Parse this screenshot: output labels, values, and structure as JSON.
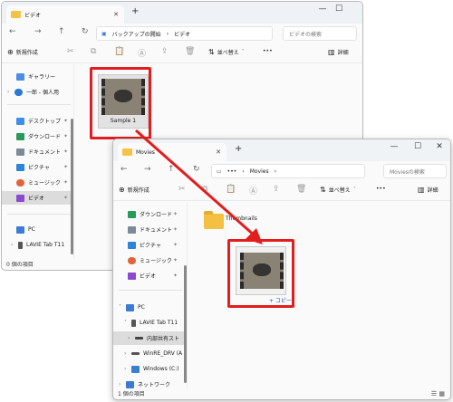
{
  "window_back": {
    "tab_title": "ビデオ",
    "address_segments": [
      "バックアップの開始",
      "›",
      "ビデオ"
    ],
    "search_placeholder": "ビデオの検索",
    "toolbar": {
      "new_label": "新規作成",
      "sort_label": "並べ替え",
      "more_label": "•••",
      "details_label": "詳細"
    },
    "sidebar": [
      {
        "label": "ギャラリー",
        "color": "#4e8de6"
      },
      {
        "label": "一郎 - 個人用",
        "color": "#2a77d4"
      },
      {
        "label": "デスクトップ",
        "color": "#3f8fe8"
      },
      {
        "label": "ダウンロード",
        "color": "#2a9a59"
      },
      {
        "label": "ドキュメント",
        "color": "#7a8a99"
      },
      {
        "label": "ピクチャ",
        "color": "#2e84d6"
      },
      {
        "label": "ミュージック",
        "color": "#e2643a"
      },
      {
        "label": "ビデオ",
        "color": "#8a4ad0"
      },
      {
        "label": "PC",
        "color": "#3b7bd4"
      },
      {
        "label": "LAVIE Tab T11",
        "color": "#555555"
      }
    ],
    "file": {
      "name": "Sample 1"
    },
    "status": "0 個の項目"
  },
  "window_front": {
    "tab_title": "Movies",
    "address_segments": [
      "•••",
      "›",
      "Movies",
      "›"
    ],
    "search_placeholder": "Moviesの検索",
    "toolbar": {
      "new_label": "新規作成",
      "sort_label": "並べ替え",
      "more_label": "•••",
      "details_label": "詳細"
    },
    "sidebar": [
      {
        "label": "ダウンロード",
        "color": "#2a9a59"
      },
      {
        "label": "ドキュメント",
        "color": "#7a8a99"
      },
      {
        "label": "ピクチャ",
        "color": "#2e84d6"
      },
      {
        "label": "ミュージック",
        "color": "#e2643a"
      },
      {
        "label": "ビデオ",
        "color": "#8a4ad0"
      },
      {
        "label": "PC",
        "color": "#3b7bd4"
      },
      {
        "label": "LAVIE Tab T11",
        "color": "#555555"
      },
      {
        "label": "内部共有スト",
        "color": "#444444"
      },
      {
        "label": "WinRE_DRV (A",
        "color": "#555555"
      },
      {
        "label": "Windows (C:)",
        "color": "#3a7fd0"
      },
      {
        "label": "ネットワーク",
        "color": "#3b7bd4"
      }
    ],
    "folder": {
      "name": "Thumbnails"
    },
    "copy_badge": "+ コピー",
    "status": "1 個の項目"
  },
  "colors": {
    "accent_red": "#e21d1d",
    "selection": "#dcdcdc"
  }
}
